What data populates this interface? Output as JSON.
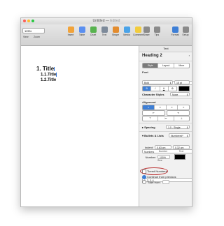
{
  "window": {
    "title": "Untitled",
    "subtitle": "Edited",
    "traffic_colors": [
      "#ff5f57",
      "#febc2e",
      "#28c840"
    ]
  },
  "toolbar": {
    "zoom_value": "125%",
    "view_label": "View",
    "zoom_label": "Zoom",
    "items": [
      {
        "label": "Insert",
        "icon": "insert-icon",
        "color": "#f1a33a"
      },
      {
        "label": "Table",
        "icon": "table-icon",
        "color": "#5a8ff0"
      },
      {
        "label": "Chart",
        "icon": "chart-icon",
        "color": "#58b34f"
      },
      {
        "label": "Text",
        "icon": "text-icon",
        "color": "#7d8a9a"
      },
      {
        "label": "Shape",
        "icon": "shape-icon",
        "color": "#e38c2e"
      },
      {
        "label": "Media",
        "icon": "media-icon",
        "color": "#4aa3e8"
      },
      {
        "label": "Comment",
        "icon": "comment-icon",
        "color": "#f2cc3d"
      }
    ],
    "right_items": [
      {
        "label": "Share",
        "icon": "share-icon"
      },
      {
        "label": "Tips",
        "icon": "tips-icon"
      },
      {
        "label": "Format",
        "icon": "format-icon"
      },
      {
        "label": "Setup",
        "icon": "setup-icon"
      }
    ]
  },
  "document": {
    "line1": "1.  Title",
    "line2": "1.1.Title",
    "line3": "1.2.Title"
  },
  "panel": {
    "tab": "Text",
    "style_name": "Heading 2",
    "segments": [
      "Style",
      "Layout",
      "More"
    ],
    "font_header": "Font",
    "font_family": "Helvetica",
    "font_weight": "Bold",
    "font_size": "15 pt",
    "char_styles_label": "Character Styles",
    "char_styles_value": "None",
    "alignment_header": "Alignment",
    "spacing_label": "Spacing",
    "spacing_value": "1.0 - Single",
    "bullets_label": "Bullets & Lists",
    "bullets_value": "Numbered*",
    "numbers_value": "Numbers",
    "indent_label": "Indent:",
    "indent_number": "0.63 cm",
    "indent_text": "0.32 cm",
    "number_col": "Number",
    "text_col": "Text",
    "number_label": "Number:",
    "number_size": "100%",
    "size_label": "Size",
    "format_value": "1, 2, 3, 4",
    "tiered_label": "Tiered Numbers",
    "continue_label": "Continue from previous",
    "start_label": "Start from:"
  }
}
